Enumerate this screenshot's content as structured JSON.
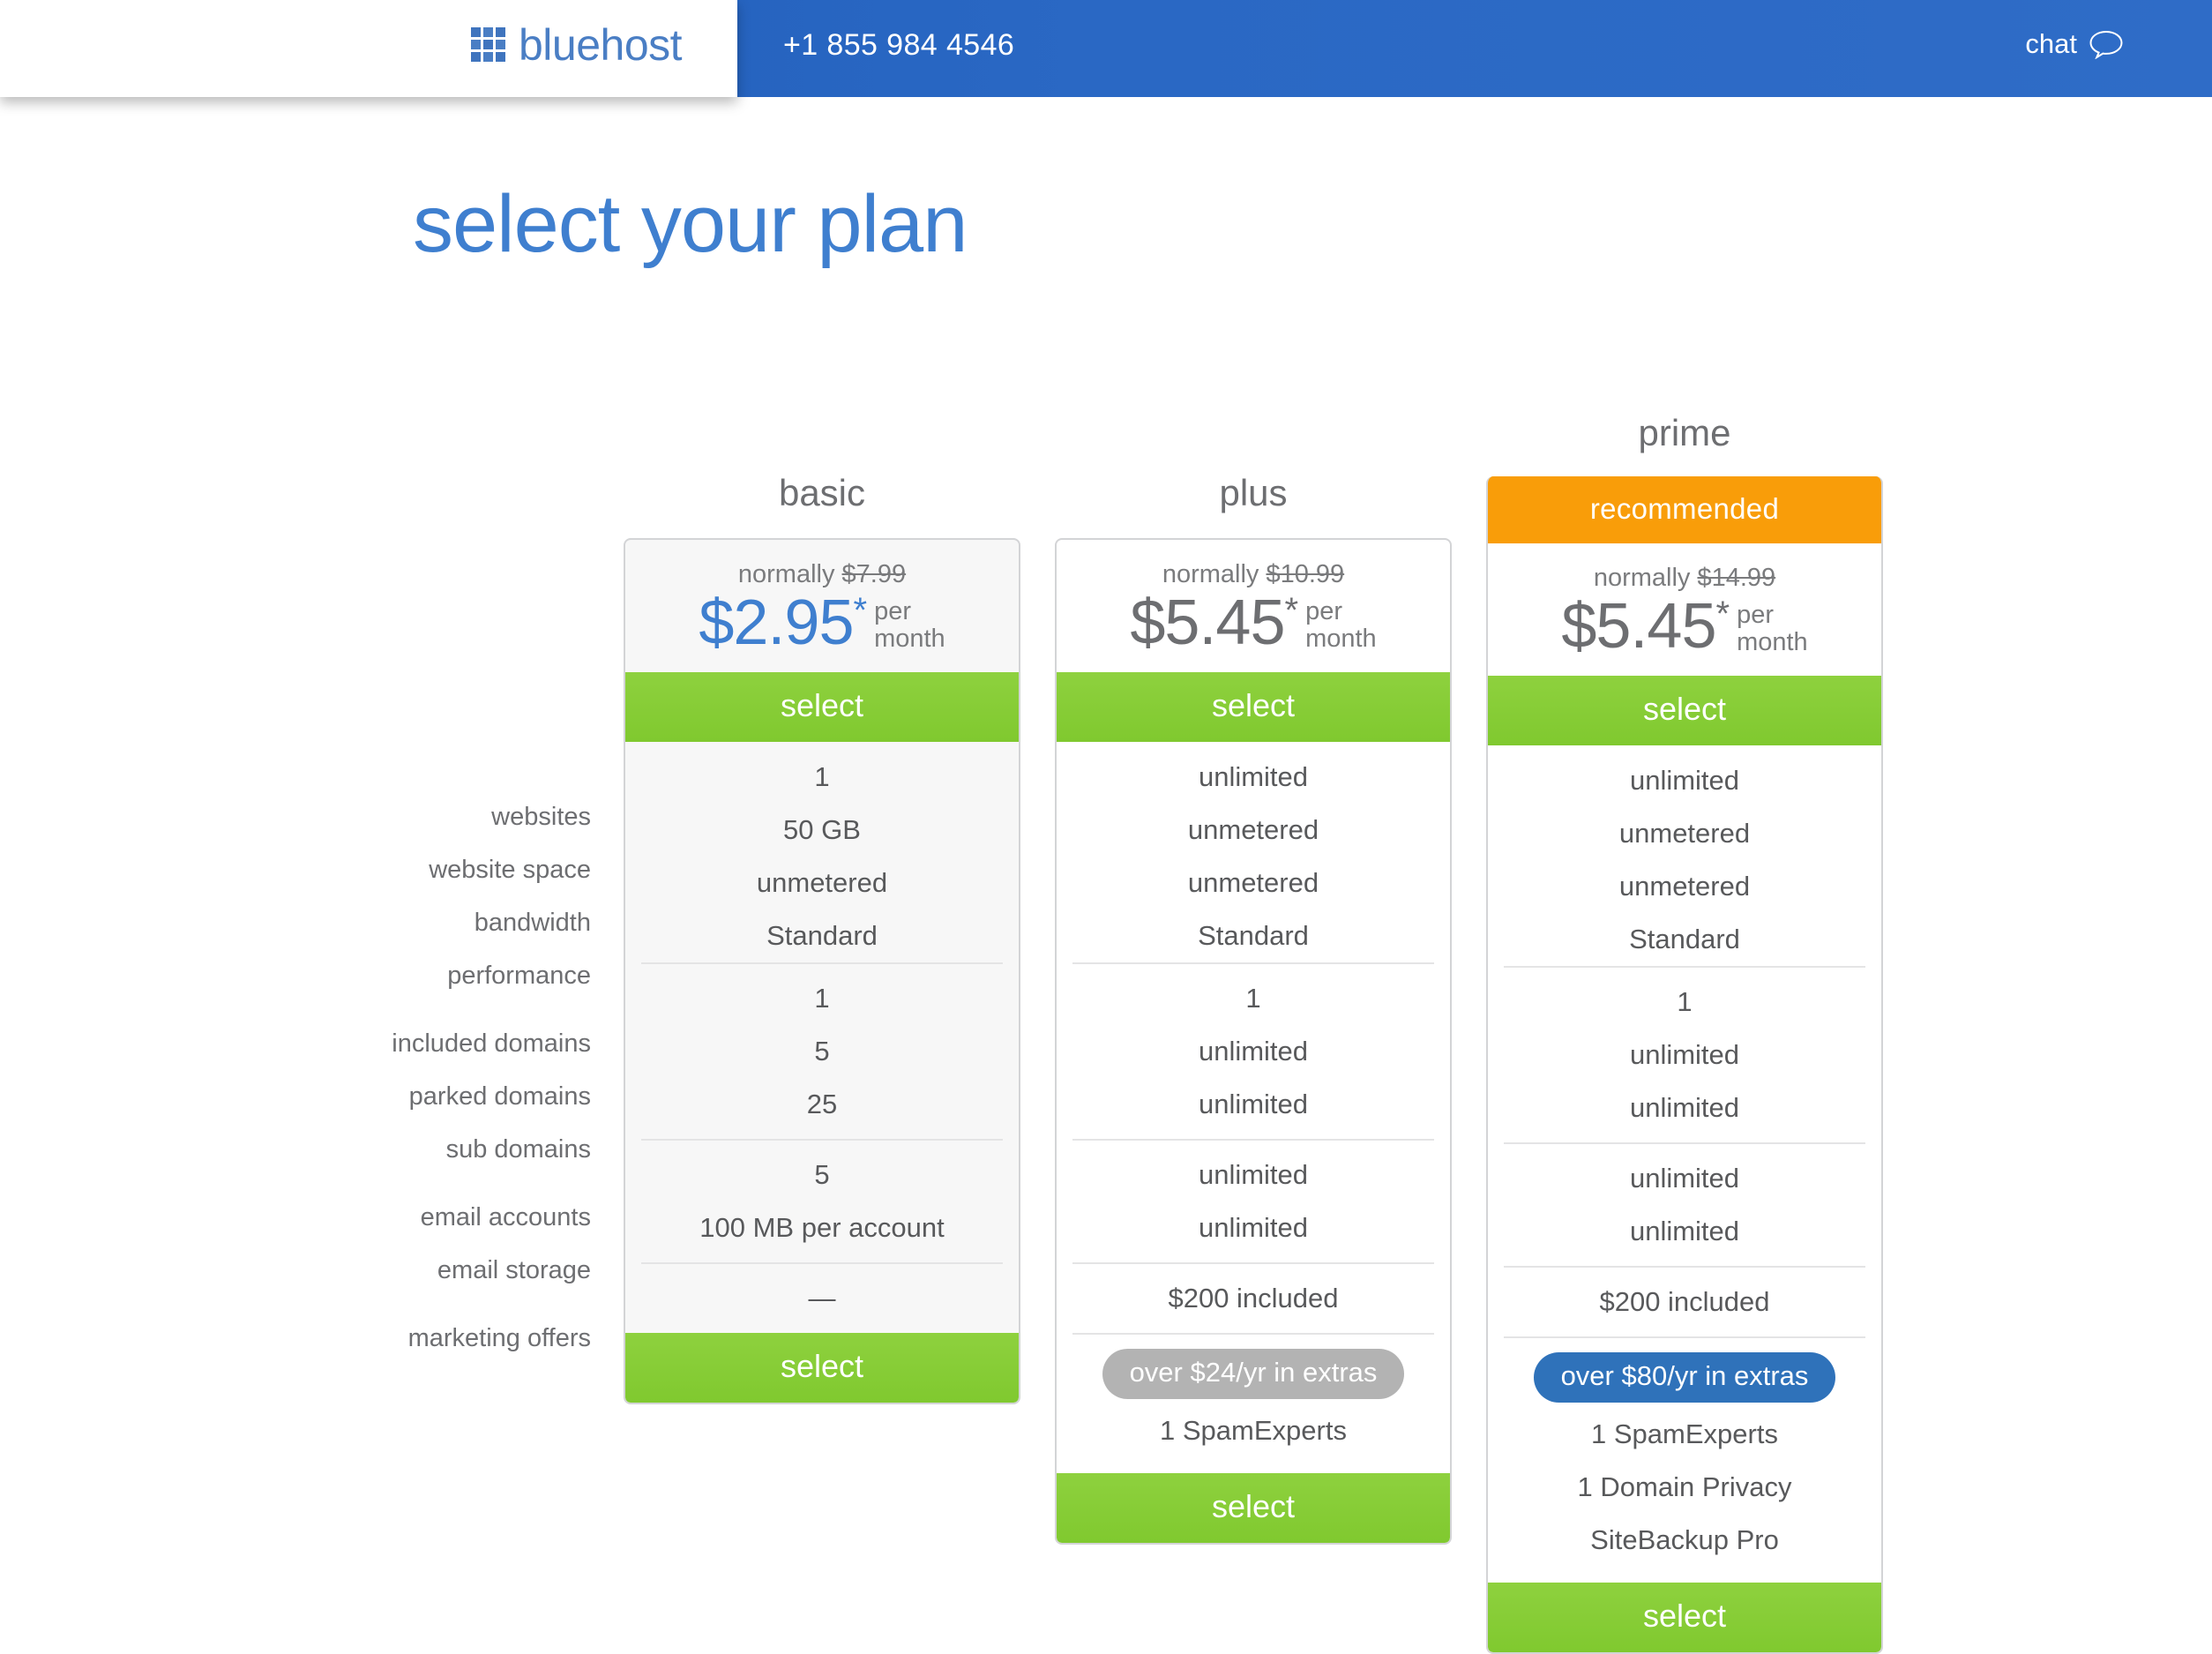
{
  "header": {
    "logo_text": "bluehost",
    "logo_icon": "grid-squares-icon",
    "phone": "+1 855 984 4546",
    "chat_label": "chat",
    "chat_icon": "speech-bubble-icon",
    "blue": "#2362bd",
    "logo_blue": "#4a7ec4"
  },
  "page": {
    "title": "select your plan",
    "title_color": "#3f7fcf"
  },
  "feature_labels": {
    "group1": [
      "websites",
      "website space",
      "bandwidth",
      "performance"
    ],
    "group2": [
      "included domains",
      "parked domains",
      "sub domains"
    ],
    "group3": [
      "email accounts",
      "email storage"
    ],
    "group4": [
      "marketing offers"
    ]
  },
  "colors": {
    "select_green": "#85ce36",
    "recommended_orange": "#f99d09",
    "pill_gray": "#b3b3b3",
    "pill_blue": "#2f72ba",
    "price_blue": "#3f7fcf",
    "price_gray": "#6d6e71"
  },
  "plans": [
    {
      "id": "basic",
      "name": "basic",
      "badge": null,
      "normally_label": "normally",
      "normally_price": "$7.99",
      "price": "$2.95",
      "star": "*",
      "per": "per",
      "month": "month",
      "price_color": "blue",
      "select_label": "select",
      "group1": [
        "1",
        "50 GB",
        "unmetered",
        "Standard"
      ],
      "group2": [
        "1",
        "5",
        "25"
      ],
      "group3": [
        "5",
        "100 MB per account"
      ],
      "group4": [
        "—"
      ],
      "extras_pill": null,
      "extras_items": []
    },
    {
      "id": "plus",
      "name": "plus",
      "badge": null,
      "normally_label": "normally",
      "normally_price": "$10.99",
      "price": "$5.45",
      "star": "*",
      "per": "per",
      "month": "month",
      "price_color": "gray",
      "select_label": "select",
      "group1": [
        "unlimited",
        "unmetered",
        "unmetered",
        "Standard"
      ],
      "group2": [
        "1",
        "unlimited",
        "unlimited"
      ],
      "group3": [
        "unlimited",
        "unlimited"
      ],
      "group4": [
        "$200 included"
      ],
      "extras_pill": "over $24/yr in extras",
      "extras_pill_style": "gray",
      "extras_items": [
        "1 SpamExperts"
      ]
    },
    {
      "id": "prime",
      "name": "prime",
      "badge": "recommended",
      "normally_label": "normally",
      "normally_price": "$14.99",
      "price": "$5.45",
      "star": "*",
      "per": "per",
      "month": "month",
      "price_color": "gray",
      "select_label": "select",
      "group1": [
        "unlimited",
        "unmetered",
        "unmetered",
        "Standard"
      ],
      "group2": [
        "1",
        "unlimited",
        "unlimited"
      ],
      "group3": [
        "unlimited",
        "unlimited"
      ],
      "group4": [
        "$200 included"
      ],
      "extras_pill": "over $80/yr in extras",
      "extras_pill_style": "blue",
      "extras_items": [
        "1 SpamExperts",
        "1 Domain Privacy",
        "SiteBackup Pro"
      ]
    }
  ]
}
